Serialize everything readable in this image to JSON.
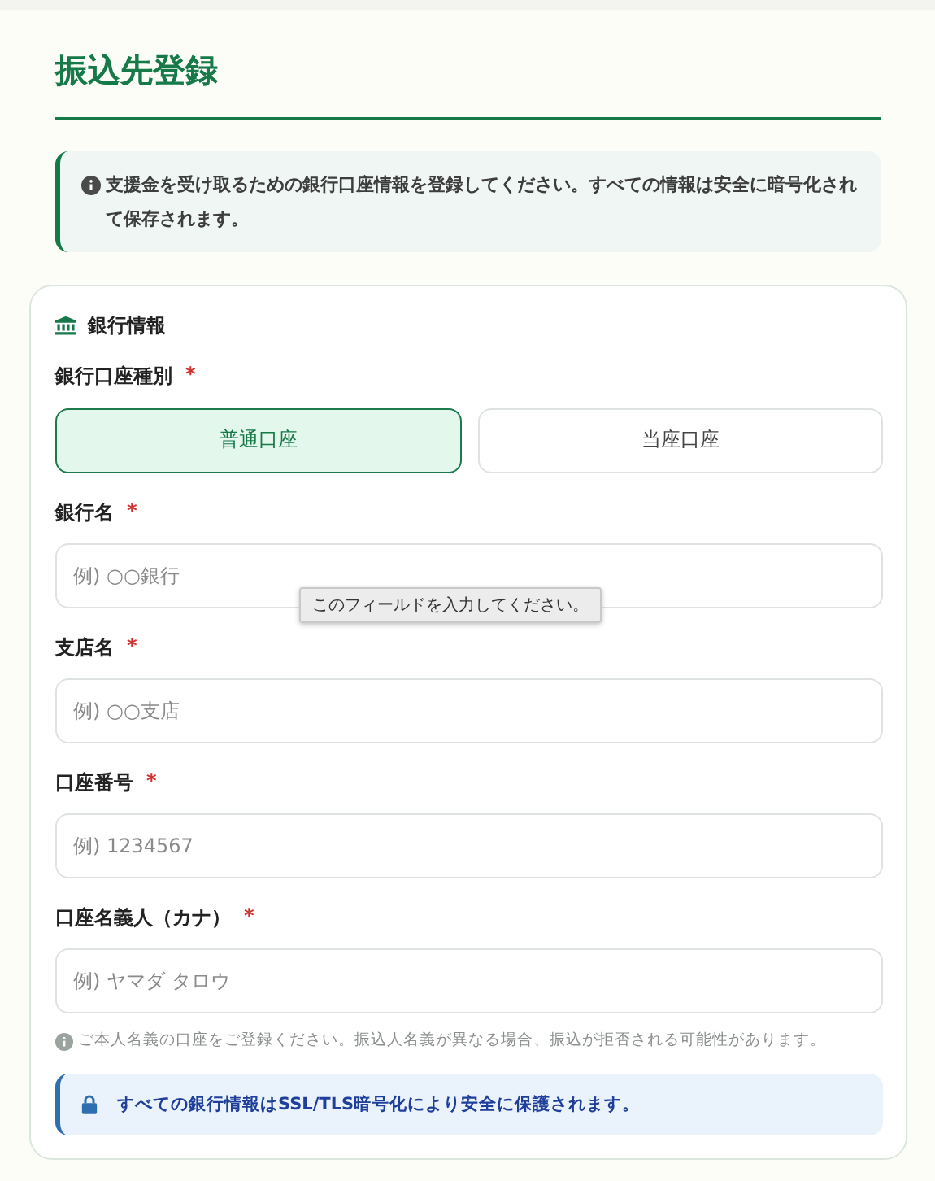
{
  "page": {
    "title": "振込先登録"
  },
  "notice": {
    "text": "支援金を受け取るための銀行口座情報を登録してください。すべての情報は安全に暗号化されて保存されます。"
  },
  "card": {
    "heading": "銀行情報",
    "account_type": {
      "label": "銀行口座種別",
      "required_mark": "*",
      "options": [
        {
          "label": "普通口座",
          "selected": true
        },
        {
          "label": "当座口座",
          "selected": false
        }
      ]
    },
    "fields": [
      {
        "label": "銀行名",
        "required_mark": "*",
        "placeholder": "例) ○○銀行",
        "tooltip": "このフィールドを入力してください。"
      },
      {
        "label": "支店名",
        "required_mark": "*",
        "placeholder": "例) ○○支店"
      },
      {
        "label": "口座番号",
        "required_mark": "*",
        "placeholder": "例) 1234567"
      },
      {
        "label": "口座名義人（カナ）",
        "required_mark": "*",
        "placeholder": "例) ヤマダ タロウ"
      }
    ],
    "hint": "ご本人名義の口座をご登録ください。振込人名義が異なる場合、振込が拒否される可能性があります。",
    "security": "すべての銀行情報はSSL/TLS暗号化により安全に保護されます。"
  }
}
